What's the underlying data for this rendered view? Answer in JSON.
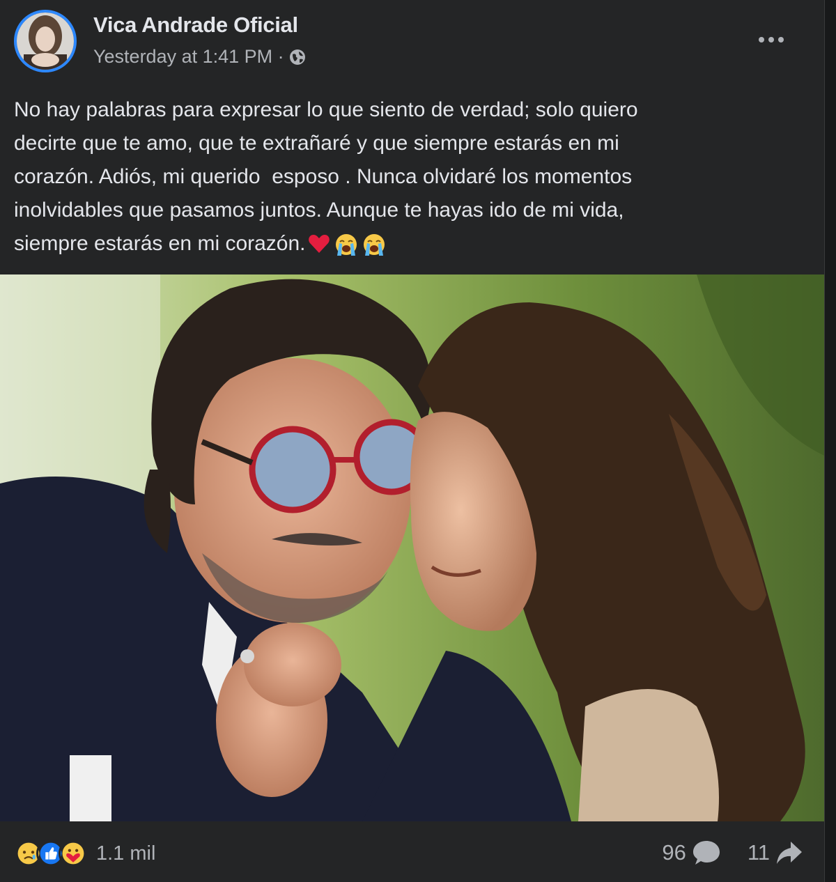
{
  "post": {
    "author": "Vica Andrade Oficial",
    "timestamp": "Yesterday at 1:41 PM · ",
    "audience_icon": "globe-icon",
    "text": "No hay palabras para expresar lo que siento de verdad; solo quiero\ndecirte que te amo, que te extrañaré y que siempre estarás en mi\ncorazón. Adiós, mi querido  esposo . Nunca olvidaré los momentos\ninolvidables que pasamos juntos. Aunque te hayas ido de mi vida,\nsiempre estarás en mi corazón.",
    "trailing_emojis": [
      "heart",
      "loudly-crying-face",
      "loudly-crying-face"
    ]
  },
  "footer": {
    "reaction_icons": [
      "sad-reaction-icon",
      "like-reaction-icon",
      "care-reaction-icon"
    ],
    "reaction_count": "1.1 mil",
    "comment_count": "96",
    "share_count": "11"
  },
  "colors": {
    "background": "#242526",
    "text": "#e4e6eb",
    "secondary_text": "#b0b3b8",
    "accent": "#2d88ff"
  }
}
